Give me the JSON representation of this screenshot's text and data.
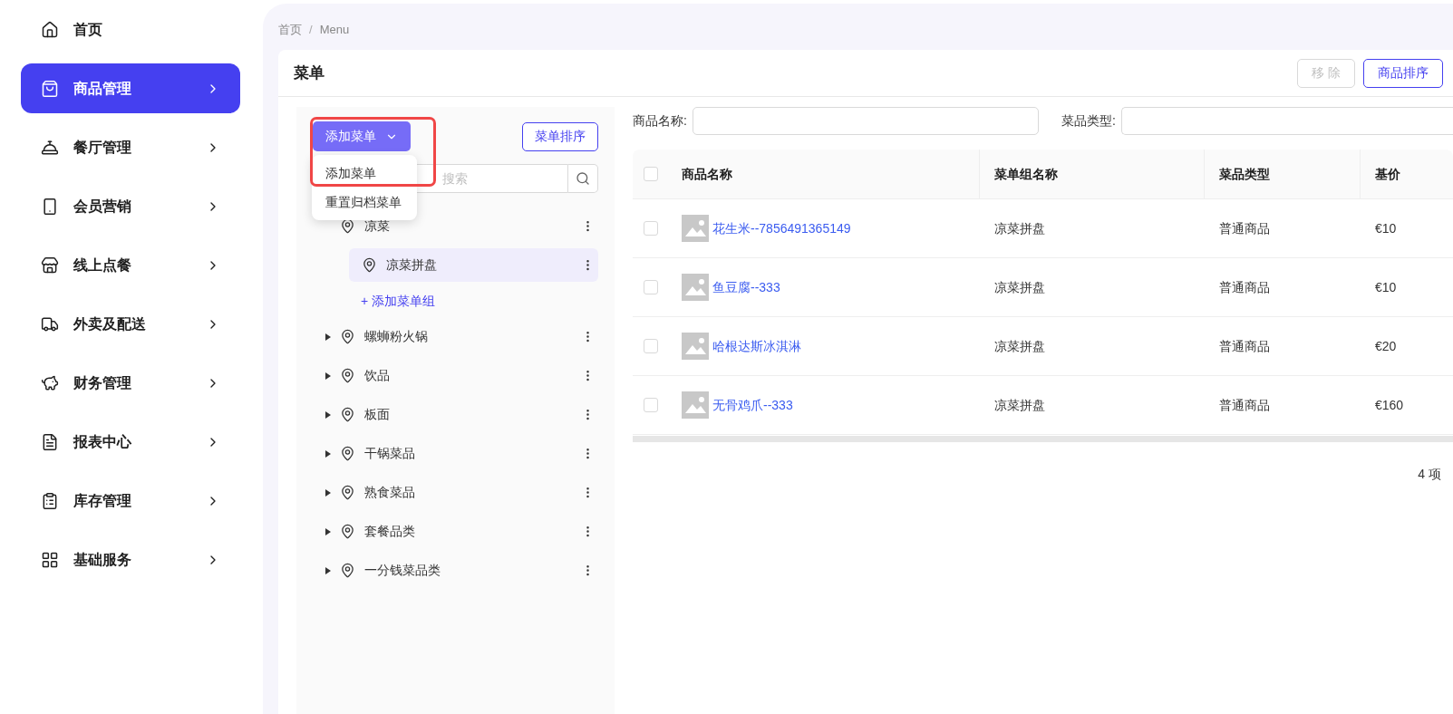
{
  "sidebar": {
    "items": [
      {
        "label": "首页",
        "selected": false,
        "has_arrow": false
      },
      {
        "label": "商品管理",
        "selected": true,
        "has_arrow": true
      },
      {
        "label": "餐厅管理",
        "selected": false,
        "has_arrow": true
      },
      {
        "label": "会员营销",
        "selected": false,
        "has_arrow": true
      },
      {
        "label": "线上点餐",
        "selected": false,
        "has_arrow": true
      },
      {
        "label": "外卖及配送",
        "selected": false,
        "has_arrow": true
      },
      {
        "label": "财务管理",
        "selected": false,
        "has_arrow": true
      },
      {
        "label": "报表中心",
        "selected": false,
        "has_arrow": true
      },
      {
        "label": "库存管理",
        "selected": false,
        "has_arrow": true
      },
      {
        "label": "基础服务",
        "selected": false,
        "has_arrow": true
      }
    ]
  },
  "breadcrumb": {
    "items": [
      "首页",
      "Menu"
    ],
    "separator": "/"
  },
  "card": {
    "title": "菜单",
    "actions": [
      {
        "label": "移 除",
        "disabled": true
      },
      {
        "label": "商品排序",
        "disabled": false
      }
    ]
  },
  "menu_panel": {
    "add_button": "添加菜单",
    "sort_button": "菜单排序",
    "search": {
      "placeholder": "搜索"
    },
    "dropdown": [
      "添加菜单",
      "重置归档菜单"
    ],
    "tree": [
      {
        "label": "凉菜",
        "expanded": true,
        "children": [
          {
            "label": "凉菜拼盘",
            "selected": true
          }
        ],
        "add_link": "+ 添加菜单组"
      },
      {
        "label": "螺蛳粉火锅",
        "expanded": false
      },
      {
        "label": "饮品",
        "expanded": false
      },
      {
        "label": "板面",
        "expanded": false
      },
      {
        "label": "干锅菜品",
        "expanded": false
      },
      {
        "label": "熟食菜品",
        "expanded": false
      },
      {
        "label": "套餐品类",
        "expanded": false
      },
      {
        "label": "一分钱菜品类",
        "expanded": false
      }
    ]
  },
  "filters": [
    {
      "label": "商品名称:"
    },
    {
      "label": "菜品类型:"
    }
  ],
  "table": {
    "all_checked": false,
    "columns": [
      "商品名称",
      "菜单组名称",
      "菜品类型",
      "基价"
    ],
    "rows": [
      {
        "checked": false,
        "name": "花生米--7856491365149",
        "group": "凉菜拼盘",
        "type": "普通商品",
        "price": "€10"
      },
      {
        "checked": false,
        "name": "鱼豆腐--333",
        "group": "凉菜拼盘",
        "type": "普通商品",
        "price": "€10"
      },
      {
        "checked": false,
        "name": "哈根达斯冰淇淋",
        "group": "凉菜拼盘",
        "type": "普通商品",
        "price": "€20"
      },
      {
        "checked": false,
        "name": "无骨鸡爪--333",
        "group": "凉菜拼盘",
        "type": "普通商品",
        "price": "€160"
      }
    ]
  },
  "footer": {
    "count": "4 项"
  }
}
